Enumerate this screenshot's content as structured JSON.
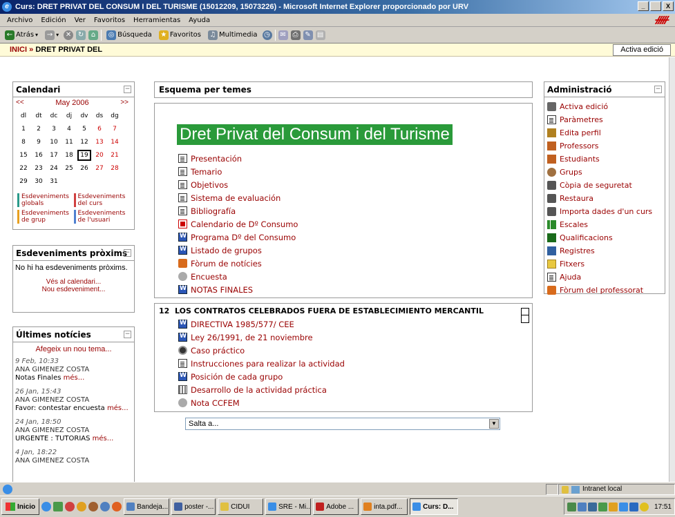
{
  "window": {
    "title": "Curs: DRET PRIVAT DEL CONSUM I DEL TURISME (15012209, 15073226) - Microsoft Internet Explorer proporcionado por URV",
    "buttons": [
      "_",
      " ",
      "X"
    ]
  },
  "menu": [
    "Archivo",
    "Edición",
    "Ver",
    "Favoritos",
    "Herramientas",
    "Ayuda"
  ],
  "toolbar": {
    "back": "Atrás",
    "search": "Búsqueda",
    "favorites": "Favoritos",
    "multimedia": "Multimedia"
  },
  "breadcrumb": {
    "home": "INICI",
    "separator": "»",
    "current": "DRET PRIVAT DEL"
  },
  "edit_button": "Activa edició",
  "calendar": {
    "title": "Calendari",
    "prev": "<<",
    "next": ">>",
    "month": "May 2006",
    "weekdays": [
      "dl",
      "dt",
      "dc",
      "dj",
      "dv",
      "ds",
      "dg"
    ],
    "weeks": [
      [
        "1",
        "2",
        "3",
        "4",
        "5",
        "6",
        "7"
      ],
      [
        "8",
        "9",
        "10",
        "11",
        "12",
        "13",
        "14"
      ],
      [
        "15",
        "16",
        "17",
        "18",
        "19",
        "20",
        "21"
      ],
      [
        "22",
        "23",
        "24",
        "25",
        "26",
        "27",
        "28"
      ],
      [
        "29",
        "30",
        "31",
        "",
        "",
        "",
        ""
      ]
    ],
    "today": "19",
    "legend": [
      {
        "label": "Esdeveniments globals",
        "color": "#2a9a8a"
      },
      {
        "label": "Esdeveniments del curs",
        "color": "#d04040"
      },
      {
        "label": "Esdeveniments de grup",
        "color": "#e8a020"
      },
      {
        "label": "Esdeveniments de l'usuari",
        "color": "#5080d0"
      }
    ]
  },
  "upcoming": {
    "title": "Esdeveniments pròxims",
    "empty": "No hi ha esdeveniments pròxims.",
    "link_calendar": "Vés al calendari...",
    "link_new": "Nou esdeveniment..."
  },
  "news": {
    "title": "Últimes notícies",
    "add": "Afegeix un nou tema...",
    "items": [
      {
        "date": "9 Feb, 10:33",
        "author": "ANA GIMENEZ COSTA",
        "text": "Notas Finales",
        "more": "més..."
      },
      {
        "date": "26 Jan, 15:43",
        "author": "ANA GIMENEZ COSTA",
        "text": "Favor: contestar encuesta",
        "more": "més..."
      },
      {
        "date": "24 Jan, 18:50",
        "author": "ANA GIMENEZ COSTA",
        "text": "URGENTE : TUTORIAS",
        "more": "més..."
      },
      {
        "date": "4 Jan, 18:22",
        "author": "ANA GIMENEZ COSTA",
        "text": "",
        "more": ""
      }
    ]
  },
  "main": {
    "header": "Esquema per temes",
    "course_title": "Dret Privat del Consum i del Turisme",
    "resources": [
      {
        "label": "Presentación",
        "icon": "doc"
      },
      {
        "label": "Temario",
        "icon": "doc"
      },
      {
        "label": "Objetivos",
        "icon": "doc"
      },
      {
        "label": "Sistema de evaluación",
        "icon": "doc"
      },
      {
        "label": "Bibliografía",
        "icon": "doc"
      },
      {
        "label": "Calendario de Dº Consumo",
        "icon": "pdf"
      },
      {
        "label": "Programa Dº del Consumo",
        "icon": "word"
      },
      {
        "label": "Listado de grupos",
        "icon": "word"
      },
      {
        "label": "Fòrum de notícies",
        "icon": "forum"
      },
      {
        "label": "Encuesta",
        "icon": "quiz"
      },
      {
        "label": "NOTAS FINALES",
        "icon": "word"
      }
    ],
    "section": {
      "number": "12",
      "title": "LOS CONTRATOS CELEBRADOS FUERA DE ESTABLECIMIENTO MERCANTIL",
      "items": [
        {
          "label": "DIRECTIVA 1985/577/ CEE",
          "icon": "word"
        },
        {
          "label": "Ley 26/1991, de 21 noviembre",
          "icon": "word"
        },
        {
          "label": "Caso práctico",
          "icon": "img"
        },
        {
          "label": "Instrucciones para realizar la actividad",
          "icon": "doc"
        },
        {
          "label": "Posición de cada grupo",
          "icon": "word"
        },
        {
          "label": "Desarrollo de la actividad práctica",
          "icon": "table"
        },
        {
          "label": "Nota CCFEM",
          "icon": "quiz"
        }
      ]
    },
    "jump": "Salta a..."
  },
  "admin": {
    "title": "Administració",
    "items": [
      {
        "label": "Activa edició",
        "color": "#666"
      },
      {
        "label": "Paràmetres",
        "color": "#888"
      },
      {
        "label": "Edita perfil",
        "color": "#b08020"
      },
      {
        "label": "Professors",
        "color": "#c06020"
      },
      {
        "label": "Estudiants",
        "color": "#c06020"
      },
      {
        "label": "Grups",
        "color": "#a07040"
      },
      {
        "label": "Còpia de seguretat",
        "color": "#555"
      },
      {
        "label": "Restaura",
        "color": "#555"
      },
      {
        "label": "Importa dades d'un curs",
        "color": "#555"
      },
      {
        "label": "Escales",
        "color": "#2a8a2a"
      },
      {
        "label": "Qualificacions",
        "color": "#1a6a1a"
      },
      {
        "label": "Registres",
        "color": "#3060a0"
      },
      {
        "label": "Fitxers",
        "color": "#e8c840"
      },
      {
        "label": "Ajuda",
        "color": "#777"
      },
      {
        "label": "Fòrum del professorat",
        "color": "#d86b1c"
      }
    ]
  },
  "status": {
    "zone": "Intranet local"
  },
  "taskbar": {
    "start": "Inicio",
    "tasks": [
      "Bandeja...",
      "poster -...",
      "CIDUI",
      "SRE - Mi...",
      "Adobe ...",
      "inta.pdf...",
      "Curs: D..."
    ],
    "active": "Curs: D...",
    "clock": "17:51"
  }
}
